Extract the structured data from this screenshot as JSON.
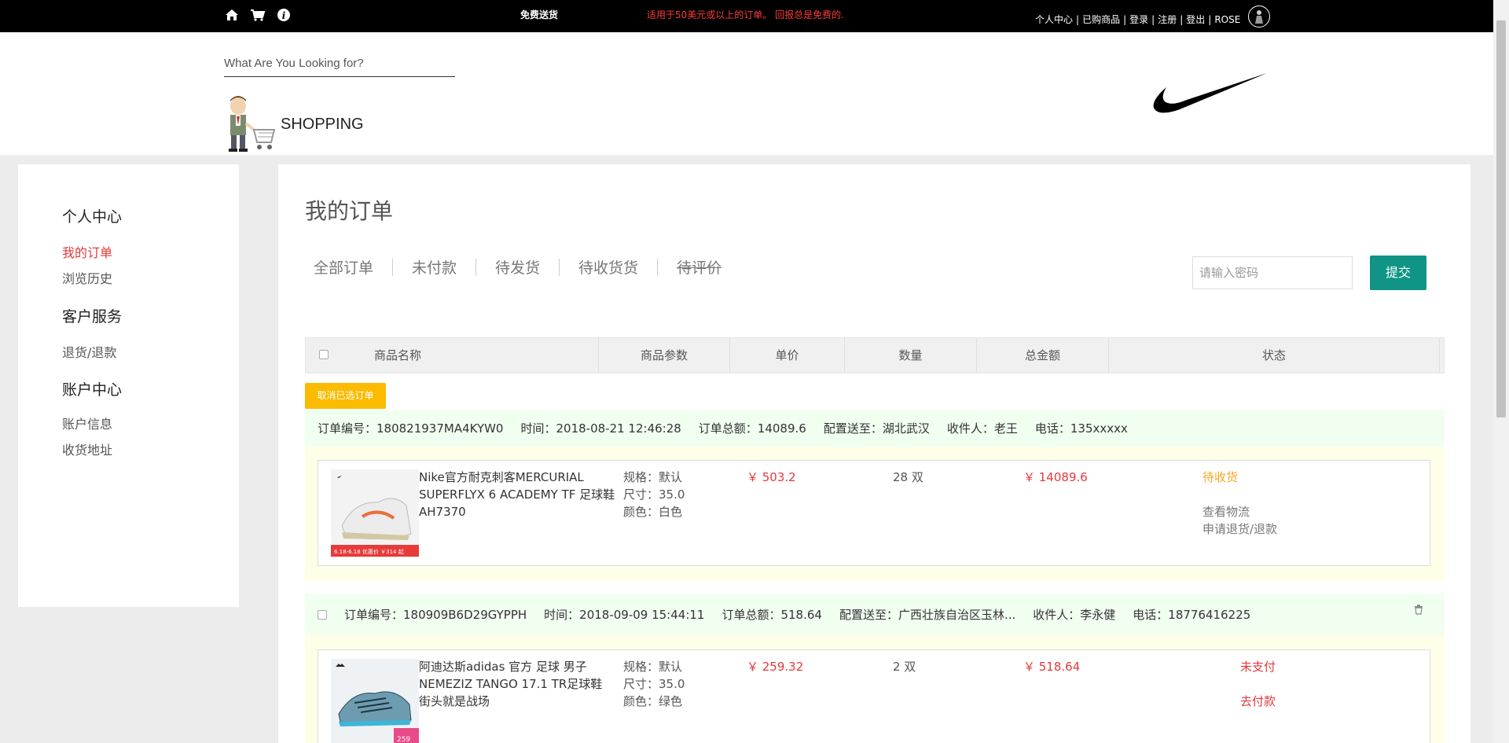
{
  "topbar": {
    "icons": [
      "home-icon",
      "cart-icon",
      "info-icon"
    ],
    "shipping": "免费送货",
    "promo": "适用于50美元或以上的订单。 回报总是免费的.",
    "links": [
      "个人中心",
      "已购商品",
      "登录",
      "注册",
      "登出",
      "ROSE"
    ]
  },
  "header": {
    "search_placeholder": "What Are You Looking for?",
    "shopping_label": "SHOPPING"
  },
  "sidebar": {
    "group1": "个人中心",
    "my_orders": "我的订单",
    "history": "浏览历史",
    "group2": "客户服务",
    "returns": "退货/退款",
    "group3": "账户中心",
    "account_info": "账户信息",
    "address": "收货地址"
  },
  "main": {
    "title": "我的订单",
    "tabs": [
      "全部订单",
      "未付款",
      "待发货",
      "待收货货",
      "待评价"
    ],
    "password_placeholder": "请输入密码",
    "submit": "提交",
    "columns": [
      "商品名称",
      "商品参数",
      "单价",
      "数量",
      "总金额",
      "状态"
    ],
    "cancel_selected": "取消已选订单"
  },
  "orders": [
    {
      "order_no": "订单编号：180821937MA4KYW0",
      "time": "时间：2018-08-21 12:46:28",
      "order_total": "订单总额：14089.6",
      "ship_to": "配置送至：湖北武汉",
      "receiver": "收件人：老王",
      "phone": "电话：135xxxxx",
      "name": "Nike官方耐克刺客MERCURIAL SUPERFLYX 6 ACADEMY TF 足球鞋AH7370",
      "spec": "规格：默认",
      "size": "尺寸：35.0",
      "color": "颜色：白色",
      "price": "￥ 503.2",
      "qty": "28 双",
      "total": "￥ 14089.6",
      "status": "待收货",
      "action1": "查看物流",
      "action2": "申请退货/退款",
      "img_badge": "6.18-6.18  优惠价 ￥314 起"
    },
    {
      "order_no": "订单编号：180909B6D29GYPPH",
      "time": "时间：2018-09-09 15:44:11",
      "order_total": "订单总额：518.64",
      "ship_to": "配置送至：广西壮族自治区玉林...",
      "receiver": "收件人：李永健",
      "phone": "电话：18776416225",
      "name": "阿迪达斯adidas 官方 足球 男子 NEMEZIZ TANGO 17.1 TR足球鞋 街头就是战场",
      "spec": "规格：默认",
      "size": "尺寸：35.0",
      "color": "颜色：绿色",
      "price": "￥ 259.32",
      "qty": "2 双",
      "total": "￥ 518.64",
      "status": "未支付",
      "action1": "去付款",
      "img_badge": "259"
    }
  ],
  "colors": {
    "accent_red": "#e4393c",
    "status_orange": "#f5a623",
    "submit_green": "#0f9486",
    "cancel_yellow": "#fabb00"
  }
}
